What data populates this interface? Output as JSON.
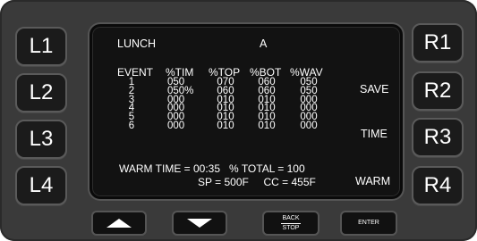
{
  "side_buttons": {
    "left": [
      "L1",
      "L2",
      "L3",
      "L4"
    ],
    "right": [
      "R1",
      "R2",
      "R3",
      "R4"
    ]
  },
  "screen": {
    "mode": "LUNCH",
    "slot": "A",
    "headers": [
      "EVENT",
      "%TIM",
      "%TOP",
      "%BOT",
      "%WAV"
    ],
    "columns": {
      "event": [
        "1",
        "2",
        "3",
        "4",
        "5",
        "6"
      ],
      "tim": [
        "050",
        "050%",
        "000",
        "000",
        "000",
        "000"
      ],
      "top": [
        "070",
        "060",
        "010",
        "010",
        "010",
        "010"
      ],
      "bot": [
        "060",
        "060",
        "010",
        "010",
        "010",
        "010"
      ],
      "wav": [
        "050",
        "050",
        "000",
        "000",
        "000",
        "000"
      ]
    },
    "side_labels": {
      "save": "SAVE",
      "time": "TIME",
      "warm": "WARM"
    },
    "warm_line": "WARM TIME = 00:35   % TOTAL = 100",
    "setpoint_line": "SP = 500F     CC = 455F"
  },
  "bottom_buttons": {
    "back": "BACK",
    "stop": "STOP",
    "enter": "ENTER"
  }
}
